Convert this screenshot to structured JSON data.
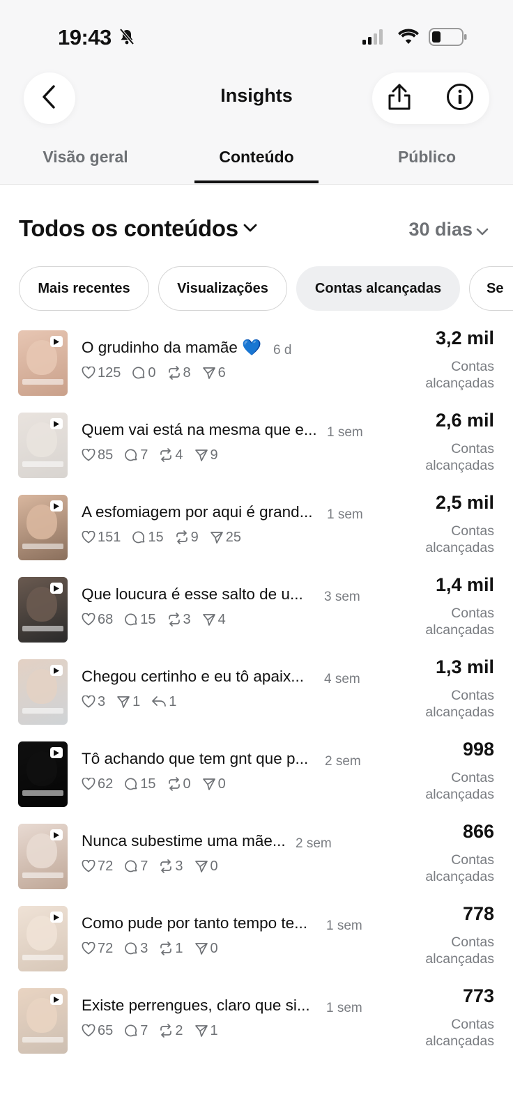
{
  "status_bar": {
    "time": "19:43",
    "icons": [
      "bell-slash-icon",
      "signal-icon",
      "wifi-icon",
      "battery-icon"
    ]
  },
  "header": {
    "title": "Insights",
    "back_icon": "chevron-left-icon",
    "share_icon": "share-icon",
    "info_icon": "info-icon"
  },
  "tabs": [
    {
      "label": "Visão geral",
      "active": false
    },
    {
      "label": "Conteúdo",
      "active": true
    },
    {
      "label": "Público",
      "active": false
    }
  ],
  "filter": {
    "title": "Todos os conteúdos",
    "period": "30 dias"
  },
  "chips": [
    {
      "label": "Mais recentes",
      "selected": false
    },
    {
      "label": "Visualizações",
      "selected": false
    },
    {
      "label": "Contas alcançadas",
      "selected": true
    },
    {
      "label": "Se",
      "selected": false
    }
  ],
  "posts": [
    {
      "title": "O grudinho da mamãe 💙",
      "age": "6 d",
      "metrics": [
        {
          "icon": "heart-icon",
          "value": "125"
        },
        {
          "icon": "comment-icon",
          "value": "0"
        },
        {
          "icon": "repost-icon",
          "value": "8"
        },
        {
          "icon": "send-icon",
          "value": "6"
        }
      ],
      "reach": "3,2 mil",
      "reach_label": "Contas alcançadas"
    },
    {
      "title": "Quem vai está na mesma que e...",
      "age": "1 sem",
      "metrics": [
        {
          "icon": "heart-icon",
          "value": "85"
        },
        {
          "icon": "comment-icon",
          "value": "7"
        },
        {
          "icon": "repost-icon",
          "value": "4"
        },
        {
          "icon": "send-icon",
          "value": "9"
        }
      ],
      "reach": "2,6 mil",
      "reach_label": "Contas alcançadas"
    },
    {
      "title": "A esfomiagem por aqui é grand...",
      "age": "1 sem",
      "metrics": [
        {
          "icon": "heart-icon",
          "value": "151"
        },
        {
          "icon": "comment-icon",
          "value": "15"
        },
        {
          "icon": "repost-icon",
          "value": "9"
        },
        {
          "icon": "send-icon",
          "value": "25"
        }
      ],
      "reach": "2,5 mil",
      "reach_label": "Contas alcançadas"
    },
    {
      "title": "Que loucura é esse salto de u...",
      "age": "3 sem",
      "metrics": [
        {
          "icon": "heart-icon",
          "value": "68"
        },
        {
          "icon": "comment-icon",
          "value": "15"
        },
        {
          "icon": "repost-icon",
          "value": "3"
        },
        {
          "icon": "send-icon",
          "value": "4"
        }
      ],
      "reach": "1,4 mil",
      "reach_label": "Contas alcançadas"
    },
    {
      "title": "Chegou certinho e eu tô apaix...",
      "age": "4 sem",
      "metrics": [
        {
          "icon": "heart-icon",
          "value": "3"
        },
        {
          "icon": "send-icon",
          "value": "1"
        },
        {
          "icon": "reply-icon",
          "value": "1"
        }
      ],
      "reach": "1,3 mil",
      "reach_label": "Contas alcançadas"
    },
    {
      "title": "Tô achando que tem gnt que p...",
      "age": "2 sem",
      "metrics": [
        {
          "icon": "heart-icon",
          "value": "62"
        },
        {
          "icon": "comment-icon",
          "value": "15"
        },
        {
          "icon": "repost-icon",
          "value": "0"
        },
        {
          "icon": "send-icon",
          "value": "0"
        }
      ],
      "reach": "998",
      "reach_label": "Contas alcançadas"
    },
    {
      "title": "Nunca subestime uma mãe...",
      "age": "2 sem",
      "metrics": [
        {
          "icon": "heart-icon",
          "value": "72"
        },
        {
          "icon": "comment-icon",
          "value": "7"
        },
        {
          "icon": "repost-icon",
          "value": "3"
        },
        {
          "icon": "send-icon",
          "value": "0"
        }
      ],
      "reach": "866",
      "reach_label": "Contas alcançadas"
    },
    {
      "title": "Como pude por tanto tempo te...",
      "age": "1 sem",
      "metrics": [
        {
          "icon": "heart-icon",
          "value": "72"
        },
        {
          "icon": "comment-icon",
          "value": "3"
        },
        {
          "icon": "repost-icon",
          "value": "1"
        },
        {
          "icon": "send-icon",
          "value": "0"
        }
      ],
      "reach": "778",
      "reach_label": "Contas alcançadas"
    },
    {
      "title": "Existe perrengues, claro que si...",
      "age": "1 sem",
      "metrics": [
        {
          "icon": "heart-icon",
          "value": "65"
        },
        {
          "icon": "comment-icon",
          "value": "7"
        },
        {
          "icon": "repost-icon",
          "value": "2"
        },
        {
          "icon": "send-icon",
          "value": "1"
        }
      ],
      "reach": "773",
      "reach_label": "Contas alcançadas"
    }
  ],
  "colors": {
    "text_primary": "#111111",
    "text_secondary": "#6e7175",
    "chip_selected_bg": "#eeeff1",
    "chip_border": "#d6d6d6",
    "heart_emoji": "#2f7cf6"
  }
}
